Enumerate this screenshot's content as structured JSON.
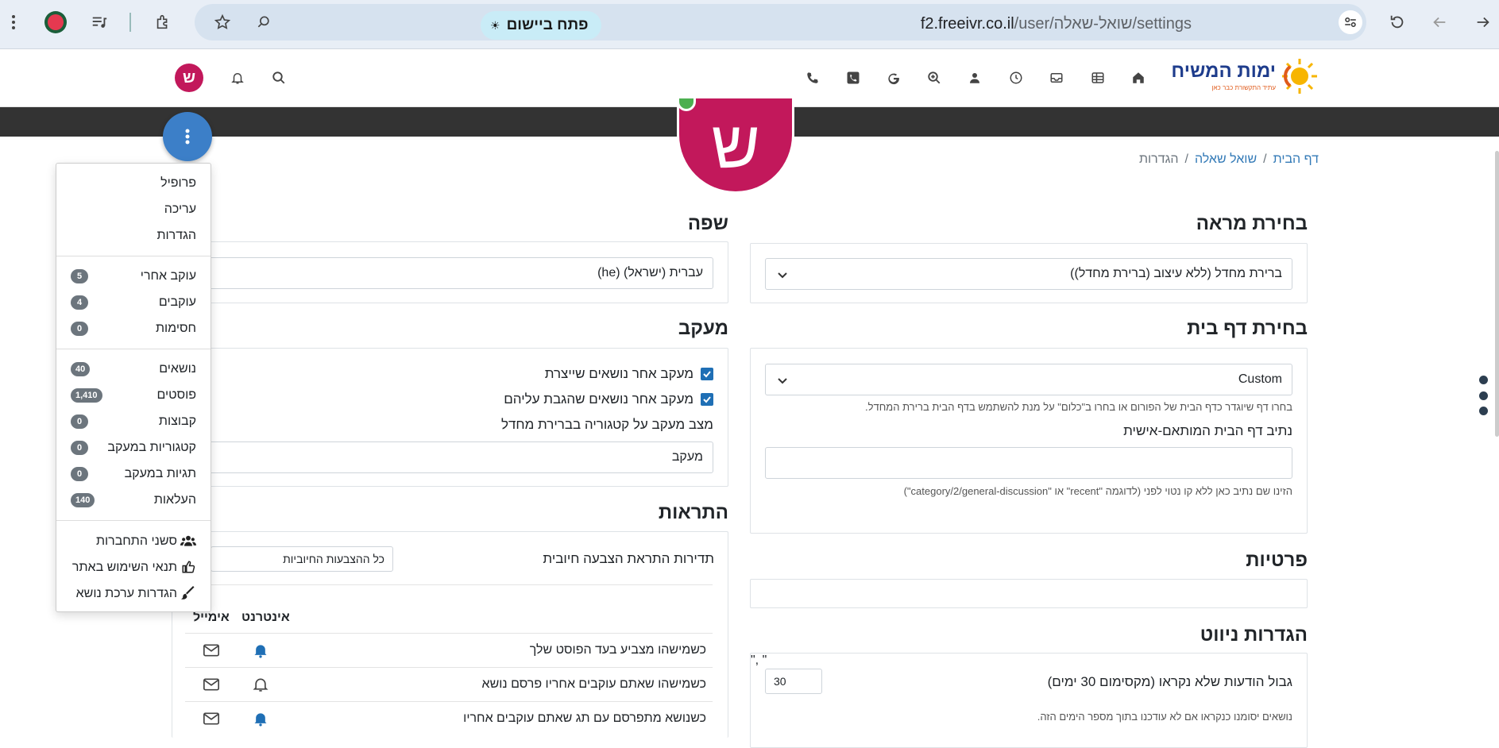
{
  "browser": {
    "url_host": "f2.freeivr.co.il",
    "url_path": "/user/שואל-שאלה/settings",
    "open_app_label": "פתח ביישום",
    "icons": [
      "forward-icon",
      "back-icon",
      "reload-icon",
      "site-settings-icon",
      "zoom-icon",
      "star-icon",
      "extensions-icon",
      "media-icon",
      "profile-icon",
      "more-icon"
    ]
  },
  "site": {
    "logo_text": "ימות המשיח",
    "logo_subtext": "עתיד התקשורת כבר כאן",
    "avatar_letter": "ש",
    "nav_icons": [
      "home-icon",
      "table-icon",
      "inbox-icon",
      "clock-icon",
      "user-icon",
      "search-plus-icon",
      "google-icon",
      "phone-square-icon",
      "phone-icon"
    ]
  },
  "breadcrumb": {
    "home": "דף הבית",
    "user": "שואל שאלה",
    "current": "הגדרות",
    "sep": "/"
  },
  "appearance": {
    "title": "בחירת מראה",
    "value": "ברירת מחדל (ללא עיצוב (ברירת מחדל))"
  },
  "homepage": {
    "title": "בחירת דף בית",
    "value": "Custom",
    "help": "בחרו דף שיוגדר כדף הבית של הפורום או בחרו ב\"כלום\" על מנת להשתמש בדף הבית ברירת המחדל.",
    "custom_label": "נתיב דף הבית המותאם-אישית",
    "custom_value": "",
    "custom_help": "הזינו שם נתיב כאן ללא קו נטוי לפני (לדוגמה \"recent\" או \"category/2/general-discussion\")"
  },
  "privacy": {
    "title": "פרטיות"
  },
  "navigation": {
    "title": "הגדרות ניווט",
    "unread_label": "גבול הודעות שלא נקראו (מקסימום 30 ימים)",
    "unread_value": "30",
    "unread_help": "נושאים יסומנו כנקראו אם לא עודכנו בתוך מספר הימים הזה."
  },
  "language": {
    "title": "שפה",
    "value": "עברית (ישראל) (he)"
  },
  "watch": {
    "title": "מעקב",
    "opt1": "מעקב אחר נושאים שייצרת",
    "opt2": "מעקב אחר נושאים שהגבת עליהם",
    "category_label": "מצב מעקב על קטגוריה בברירת מחדל",
    "category_value": "מעקב"
  },
  "notifications": {
    "title": "התראות",
    "upvote_label": "תדירות התראת הצבעה חיובית",
    "upvote_value": "כל ההצבעות החיוביות",
    "col_web": "אינטרנט",
    "col_email": "אימייל",
    "rows": [
      {
        "text": "כשמישהו מצביע בעד הפוסט שלך",
        "web": true
      },
      {
        "text": "כשמישהו שאתם עוקבים אחריו פרסם נושא",
        "web": false
      },
      {
        "text": "כשנושא מתפרסם עם תג שאתם עוקבים אחריו",
        "web": true
      }
    ]
  },
  "menu": {
    "profile": "פרופיל",
    "edit": "עריכה",
    "settings": "הגדרות",
    "following": "עוקב אחרי",
    "following_count": "5",
    "followers": "עוקבים",
    "followers_count": "4",
    "blocks": "חסימות",
    "blocks_count": "0",
    "topics": "נושאים",
    "topics_count": "40",
    "posts": "פוסטים",
    "posts_count": "1,410",
    "groups": "קבוצות",
    "groups_count": "0",
    "watched_categories": "קטגוריות במעקב",
    "watched_categories_count": "0",
    "watched_tags": "תגיות במעקב",
    "watched_tags_count": "0",
    "uploads": "העלאות",
    "uploads_count": "140",
    "sessions": "סשני התחברות",
    "terms": "תנאי השימוש באתר",
    "theme": "הגדרות ערכת נושא"
  }
}
